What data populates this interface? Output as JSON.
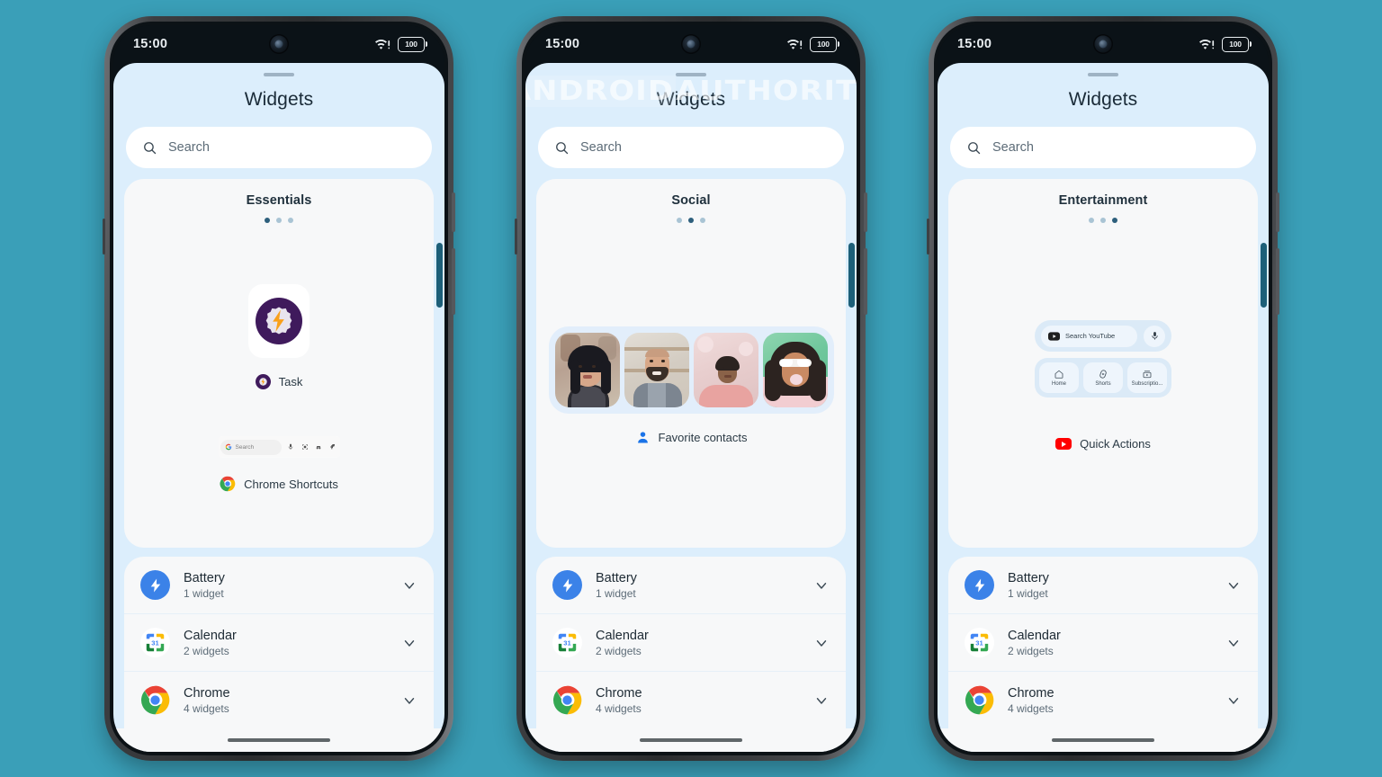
{
  "background_color": "#3a9fb8",
  "watermark": {
    "part1": "ANDROID",
    "part2": "AUTHORITY"
  },
  "status_bar": {
    "time": "15:00",
    "wifi_icon": "wifi-exclamation-icon",
    "battery_level": "100"
  },
  "sheet": {
    "title": "Widgets",
    "search": {
      "placeholder": "Search",
      "icon": "search-icon"
    }
  },
  "phones": [
    {
      "id": "phone-essentials",
      "category": "Essentials",
      "dots": [
        true,
        false,
        false
      ],
      "show_watermark": false,
      "widgets": [
        {
          "name": "Task",
          "icon": "task-lightning-icon",
          "type": "icon-tile"
        },
        {
          "name": "Chrome Shortcuts",
          "icon": "chrome-icon",
          "type": "chrome-shortcuts",
          "search_text": "Search"
        }
      ]
    },
    {
      "id": "phone-social",
      "category": "Social",
      "dots": [
        false,
        true,
        false
      ],
      "show_watermark": true,
      "widgets": [
        {
          "name": "Favorite contacts",
          "icon": "contact-person-icon",
          "type": "contacts",
          "count": 4
        }
      ]
    },
    {
      "id": "phone-entertainment",
      "category": "Entertainment",
      "dots": [
        false,
        false,
        true
      ],
      "show_watermark": false,
      "widgets": [
        {
          "name": "Quick Actions",
          "icon": "youtube-icon",
          "type": "youtube",
          "search_text": "Search YouTube",
          "mic_icon": "microphone-icon",
          "tabs": [
            {
              "label": "Home",
              "icon": "home-icon"
            },
            {
              "label": "Shorts",
              "icon": "shorts-icon"
            },
            {
              "label": "Subscriptio...",
              "icon": "subscriptions-icon"
            }
          ]
        }
      ]
    }
  ],
  "app_list": [
    {
      "name": "Battery",
      "subtitle": "1 widget",
      "icon": "battery-bolt-icon",
      "chevron": "chevron-down-icon"
    },
    {
      "name": "Calendar",
      "subtitle": "2 widgets",
      "icon": "google-calendar-icon",
      "day": "31",
      "chevron": "chevron-down-icon"
    },
    {
      "name": "Chrome",
      "subtitle": "4 widgets",
      "icon": "google-chrome-icon",
      "chevron": "chevron-down-icon"
    }
  ]
}
